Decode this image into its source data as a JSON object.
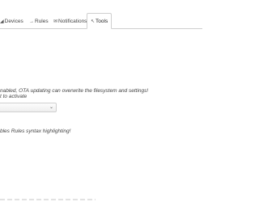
{
  "nav": {
    "tabs": [
      {
        "label": "Devices",
        "icon": "devices-icon",
        "glyph": "◢"
      },
      {
        "label": "Rules",
        "icon": "rules-icon",
        "glyph": "→"
      },
      {
        "label": "Notifications",
        "icon": "notifications-icon",
        "glyph": "✉"
      },
      {
        "label": "Tools",
        "icon": "tools-icon",
        "glyph": "↖",
        "active": true
      }
    ]
  },
  "settings": {
    "ota_note_line1": "nabled, OTA updating can overwrite the filesystem and settings!",
    "ota_note_line2": "t to activate",
    "select_value": "",
    "syntax_note": "bles Rules syntax highlighting!"
  },
  "colors": {
    "active_tab_border": "#cfcfcf",
    "text": "#333333",
    "background": "#ffffff"
  }
}
